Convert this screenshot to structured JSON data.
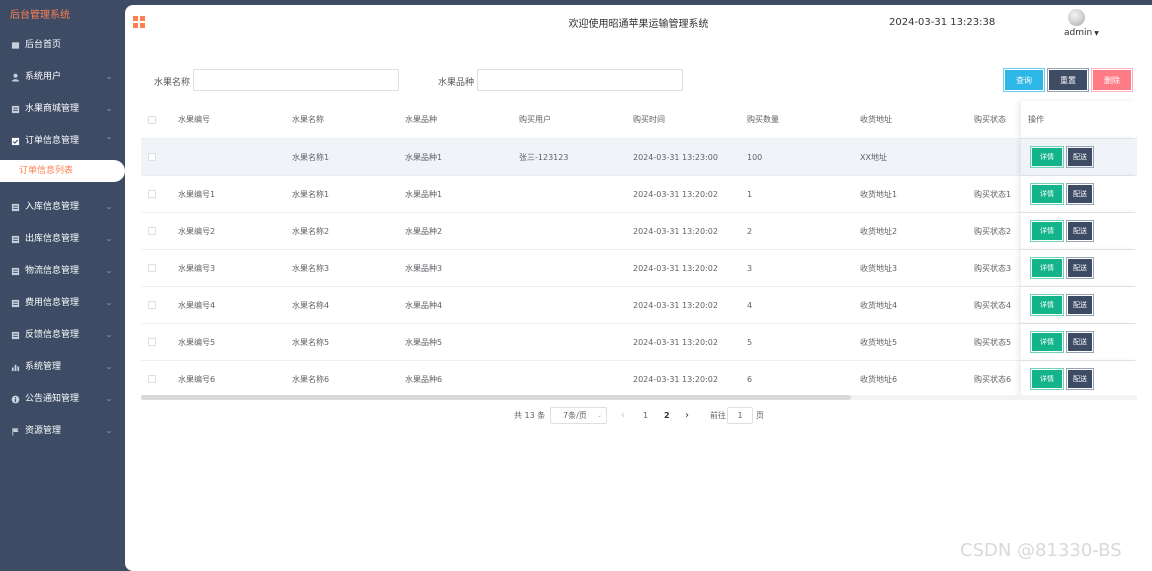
{
  "sidebar": {
    "brand": "后台管理系统",
    "items": [
      {
        "label": "后台首页",
        "icon": "home-icon",
        "chevron": ""
      },
      {
        "label": "系统用户",
        "icon": "user-icon",
        "chevron": "⌄"
      },
      {
        "label": "水果商城管理",
        "icon": "menu-icon",
        "chevron": "⌄"
      },
      {
        "label": "订单信息管理",
        "icon": "check-square-icon",
        "chevron": "⌃"
      },
      {
        "label": "入库信息管理",
        "icon": "menu-icon",
        "chevron": "⌄"
      },
      {
        "label": "出库信息管理",
        "icon": "menu-icon",
        "chevron": "⌄"
      },
      {
        "label": "物流信息管理",
        "icon": "menu-icon",
        "chevron": "⌄"
      },
      {
        "label": "费用信息管理",
        "icon": "menu-icon",
        "chevron": "⌄"
      },
      {
        "label": "反馈信息管理",
        "icon": "menu-icon",
        "chevron": "⌄"
      },
      {
        "label": "系统管理",
        "icon": "bar-chart-icon",
        "chevron": "⌄"
      },
      {
        "label": "公告通知管理",
        "icon": "info-icon",
        "chevron": "⌄"
      },
      {
        "label": "资源管理",
        "icon": "flag-icon",
        "chevron": "⌄"
      }
    ],
    "active_sub": "订单信息列表"
  },
  "header": {
    "title": "欢迎使用昭通苹果运输管理系统",
    "datetime": "2024-03-31 13:23:38",
    "user": "admin"
  },
  "search": {
    "name_label": "水果名称",
    "name_value": "",
    "variety_label": "水果品种",
    "variety_value": "",
    "query": "查询",
    "reset": "重置",
    "delete": "删除"
  },
  "table": {
    "columns": [
      "水果编号",
      "水果名称",
      "水果品种",
      "购买用户",
      "购买时间",
      "购买数量",
      "收货地址",
      "购买状态",
      "操作"
    ],
    "rows": [
      [
        "",
        "水果名称1",
        "水果品种1",
        "张三-123123",
        "2024-03-31 13:23:00",
        "100",
        "XX地址",
        ""
      ],
      [
        "水果编号1",
        "水果名称1",
        "水果品种1",
        "",
        "2024-03-31 13:20:02",
        "1",
        "收货地址1",
        "购买状态1"
      ],
      [
        "水果编号2",
        "水果名称2",
        "水果品种2",
        "",
        "2024-03-31 13:20:02",
        "2",
        "收货地址2",
        "购买状态2"
      ],
      [
        "水果编号3",
        "水果名称3",
        "水果品种3",
        "",
        "2024-03-31 13:20:02",
        "3",
        "收货地址3",
        "购买状态3"
      ],
      [
        "水果编号4",
        "水果名称4",
        "水果品种4",
        "",
        "2024-03-31 13:20:02",
        "4",
        "收货地址4",
        "购买状态4"
      ],
      [
        "水果编号5",
        "水果名称5",
        "水果品种5",
        "",
        "2024-03-31 13:20:02",
        "5",
        "收货地址5",
        "购买状态5"
      ],
      [
        "水果编号6",
        "水果名称6",
        "水果品种6",
        "",
        "2024-03-31 13:20:02",
        "6",
        "收货地址6",
        "购买状态6"
      ]
    ],
    "detail_label": "详情",
    "ship_label": "配送"
  },
  "pagination": {
    "total": "共 13 条",
    "page_size": "7条/页",
    "prev": "‹",
    "pages": [
      "1",
      "2"
    ],
    "current_page": "2",
    "next": "›",
    "goto_label": "前往",
    "goto_value": "1",
    "goto_suffix": "页"
  },
  "watermark": "CSDN @81330-BS",
  "colors": {
    "sidebar_bg": "#3d4b65",
    "accent": "#ff7f50",
    "query": "#2db7e7",
    "delete": "#ff7b85",
    "detail": "#13b48a"
  }
}
